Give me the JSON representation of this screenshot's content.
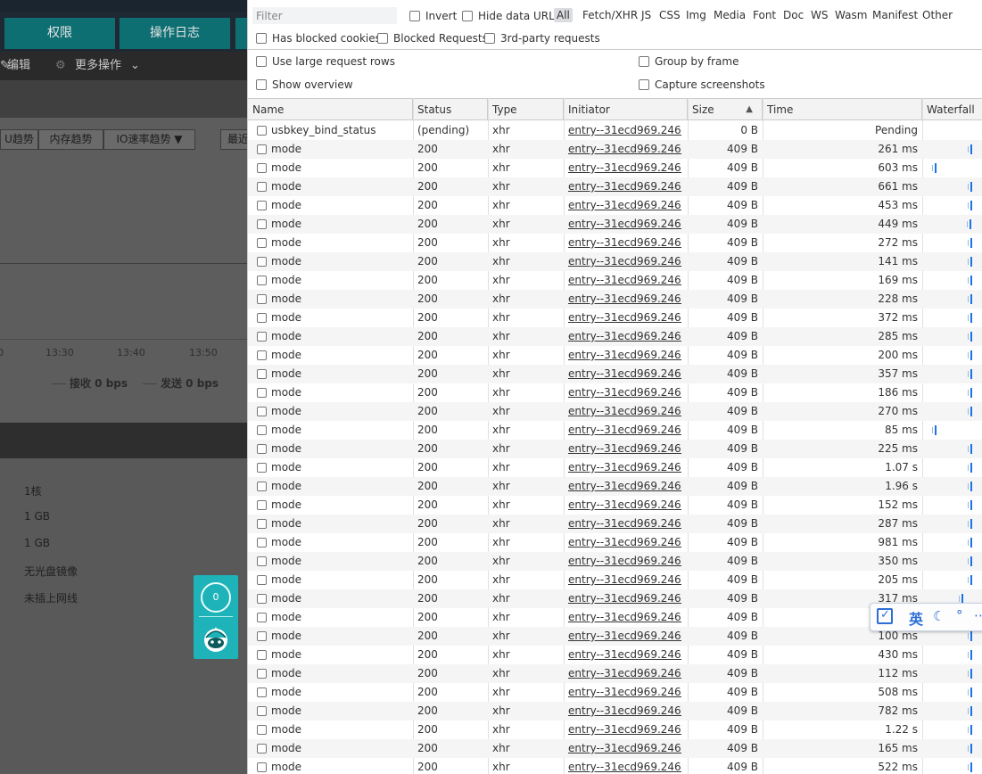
{
  "app": {
    "nav_tabs": [
      "权限",
      "操作日志"
    ],
    "actions": {
      "edit": "编辑",
      "more": "更多操作"
    },
    "trend_buttons": [
      "U趋势",
      "内存趋势",
      "IO速率趋势 ▼",
      "最近"
    ],
    "axis_ticks": [
      "0",
      "13:30",
      "13:40",
      "13:50"
    ],
    "legend": {
      "receive": "接收 0 bps",
      "send": "发送 0 bps"
    },
    "info_items": [
      "1核",
      "1 GB",
      "1 GB",
      "无光盘镜像",
      "未插上网线"
    ],
    "widget_badge": "0"
  },
  "devtools": {
    "filter_placeholder": "Filter",
    "invert": "Invert",
    "hide_data_urls": "Hide data URLs",
    "types": [
      "All",
      "Fetch/XHR",
      "JS",
      "CSS",
      "Img",
      "Media",
      "Font",
      "Doc",
      "WS",
      "Wasm",
      "Manifest",
      "Other"
    ],
    "active_type": "All",
    "has_blocked_cookies": "Has blocked cookies",
    "blocked_requests": "Blocked Requests",
    "third_party": "3rd-party requests",
    "use_large_rows": "Use large request rows",
    "group_by_frame": "Group by frame",
    "show_overview": "Show overview",
    "capture_screenshots": "Capture screenshots",
    "columns": [
      "Name",
      "Status",
      "Type",
      "Initiator",
      "Size",
      "Time",
      "Waterfall"
    ],
    "rows": [
      {
        "name": "usbkey_bind_status",
        "status": "(pending)",
        "type": "xhr",
        "initiator": "entry--31ecd969.2469...",
        "size": "0 B",
        "time": "Pending",
        "wf": null
      },
      {
        "name": "mode",
        "status": "200",
        "type": "xhr",
        "initiator": "entry--31ecd969.2469...",
        "size": "409 B",
        "time": "261 ms",
        "wf": 0.8
      },
      {
        "name": "mode",
        "status": "200",
        "type": "xhr",
        "initiator": "entry--31ecd969.2469...",
        "size": "409 B",
        "time": "603 ms",
        "wf": 0.2
      },
      {
        "name": "mode",
        "status": "200",
        "type": "xhr",
        "initiator": "entry--31ecd969.2469...",
        "size": "409 B",
        "time": "661 ms",
        "wf": 0.8
      },
      {
        "name": "mode",
        "status": "200",
        "type": "xhr",
        "initiator": "entry--31ecd969.2469...",
        "size": "409 B",
        "time": "453 ms",
        "wf": 0.8
      },
      {
        "name": "mode",
        "status": "200",
        "type": "xhr",
        "initiator": "entry--31ecd969.2469...",
        "size": "409 B",
        "time": "449 ms",
        "wf": 0.78
      },
      {
        "name": "mode",
        "status": "200",
        "type": "xhr",
        "initiator": "entry--31ecd969.2469...",
        "size": "409 B",
        "time": "272 ms",
        "wf": 0.8
      },
      {
        "name": "mode",
        "status": "200",
        "type": "xhr",
        "initiator": "entry--31ecd969.2469...",
        "size": "409 B",
        "time": "141 ms",
        "wf": 0.8
      },
      {
        "name": "mode",
        "status": "200",
        "type": "xhr",
        "initiator": "entry--31ecd969.2469...",
        "size": "409 B",
        "time": "169 ms",
        "wf": 0.8
      },
      {
        "name": "mode",
        "status": "200",
        "type": "xhr",
        "initiator": "entry--31ecd969.2469...",
        "size": "409 B",
        "time": "228 ms",
        "wf": 0.8
      },
      {
        "name": "mode",
        "status": "200",
        "type": "xhr",
        "initiator": "entry--31ecd969.2469...",
        "size": "409 B",
        "time": "372 ms",
        "wf": 0.8
      },
      {
        "name": "mode",
        "status": "200",
        "type": "xhr",
        "initiator": "entry--31ecd969.2469...",
        "size": "409 B",
        "time": "285 ms",
        "wf": 0.8
      },
      {
        "name": "mode",
        "status": "200",
        "type": "xhr",
        "initiator": "entry--31ecd969.2469...",
        "size": "409 B",
        "time": "200 ms",
        "wf": 0.8
      },
      {
        "name": "mode",
        "status": "200",
        "type": "xhr",
        "initiator": "entry--31ecd969.2469...",
        "size": "409 B",
        "time": "357 ms",
        "wf": 0.8
      },
      {
        "name": "mode",
        "status": "200",
        "type": "xhr",
        "initiator": "entry--31ecd969.2469...",
        "size": "409 B",
        "time": "186 ms",
        "wf": 0.8
      },
      {
        "name": "mode",
        "status": "200",
        "type": "xhr",
        "initiator": "entry--31ecd969.2469...",
        "size": "409 B",
        "time": "270 ms",
        "wf": 0.8
      },
      {
        "name": "mode",
        "status": "200",
        "type": "xhr",
        "initiator": "entry--31ecd969.2469...",
        "size": "409 B",
        "time": "85 ms",
        "wf": 0.2
      },
      {
        "name": "mode",
        "status": "200",
        "type": "xhr",
        "initiator": "entry--31ecd969.2469...",
        "size": "409 B",
        "time": "225 ms",
        "wf": 0.8
      },
      {
        "name": "mode",
        "status": "200",
        "type": "xhr",
        "initiator": "entry--31ecd969.2469...",
        "size": "409 B",
        "time": "1.07 s",
        "wf": 0.8
      },
      {
        "name": "mode",
        "status": "200",
        "type": "xhr",
        "initiator": "entry--31ecd969.2469...",
        "size": "409 B",
        "time": "1.96 s",
        "wf": 0.8
      },
      {
        "name": "mode",
        "status": "200",
        "type": "xhr",
        "initiator": "entry--31ecd969.2469...",
        "size": "409 B",
        "time": "152 ms",
        "wf": 0.8
      },
      {
        "name": "mode",
        "status": "200",
        "type": "xhr",
        "initiator": "entry--31ecd969.2469...",
        "size": "409 B",
        "time": "287 ms",
        "wf": 0.8
      },
      {
        "name": "mode",
        "status": "200",
        "type": "xhr",
        "initiator": "entry--31ecd969.2469...",
        "size": "409 B",
        "time": "981 ms",
        "wf": 0.8
      },
      {
        "name": "mode",
        "status": "200",
        "type": "xhr",
        "initiator": "entry--31ecd969.2469...",
        "size": "409 B",
        "time": "350 ms",
        "wf": 0.8
      },
      {
        "name": "mode",
        "status": "200",
        "type": "xhr",
        "initiator": "entry--31ecd969.2469...",
        "size": "409 B",
        "time": "205 ms",
        "wf": 0.8
      },
      {
        "name": "mode",
        "status": "200",
        "type": "xhr",
        "initiator": "entry--31ecd969.2469...",
        "size": "409 B",
        "time": "317 ms",
        "wf": 0.65
      },
      {
        "name": "mode",
        "status": "200",
        "type": "xhr",
        "initiator": "entry--31ecd969.2469...",
        "size": "409 B",
        "time": "",
        "wf": null
      },
      {
        "name": "mode",
        "status": "200",
        "type": "xhr",
        "initiator": "entry--31ecd969.2469...",
        "size": "409 B",
        "time": "100 ms",
        "wf": 0.8
      },
      {
        "name": "mode",
        "status": "200",
        "type": "xhr",
        "initiator": "entry--31ecd969.2469...",
        "size": "409 B",
        "time": "430 ms",
        "wf": 0.8
      },
      {
        "name": "mode",
        "status": "200",
        "type": "xhr",
        "initiator": "entry--31ecd969.2469...",
        "size": "409 B",
        "time": "112 ms",
        "wf": 0.8
      },
      {
        "name": "mode",
        "status": "200",
        "type": "xhr",
        "initiator": "entry--31ecd969.2469...",
        "size": "409 B",
        "time": "508 ms",
        "wf": 0.8
      },
      {
        "name": "mode",
        "status": "200",
        "type": "xhr",
        "initiator": "entry--31ecd969.2469...",
        "size": "409 B",
        "time": "782 ms",
        "wf": 0.8
      },
      {
        "name": "mode",
        "status": "200",
        "type": "xhr",
        "initiator": "entry--31ecd969.2469...",
        "size": "409 B",
        "time": "1.22 s",
        "wf": 0.8
      },
      {
        "name": "mode",
        "status": "200",
        "type": "xhr",
        "initiator": "entry--31ecd969.2469...",
        "size": "409 B",
        "time": "165 ms",
        "wf": 0.8
      },
      {
        "name": "mode",
        "status": "200",
        "type": "xhr",
        "initiator": "entry--31ecd969.2469...",
        "size": "409 B",
        "time": "522 ms",
        "wf": 0.8
      }
    ]
  },
  "ime": {
    "lang": "英"
  },
  "colors": {
    "accent": "#1a73e8",
    "teal": "#1db3b8",
    "nav_tab": "#0e6f73"
  }
}
